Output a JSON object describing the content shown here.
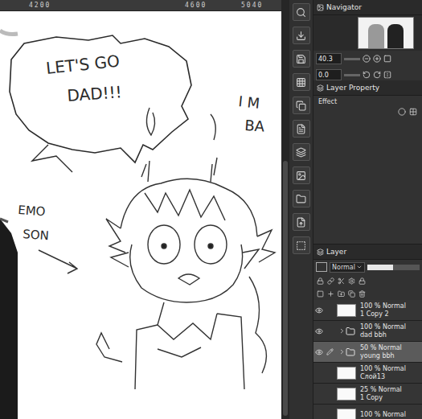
{
  "ruler": {
    "marks": [
      "4200",
      "4600",
      "5040"
    ]
  },
  "canvas": {
    "texts": [
      "LET'S GO",
      "DAD!!!",
      "I M",
      "BA",
      "EMO",
      "SON"
    ]
  },
  "navigator": {
    "title": "Navigator",
    "zoom": "40.3",
    "rotation": "0.0"
  },
  "property_panel": {
    "title": "Layer Property",
    "section": "Effect"
  },
  "layer_panel": {
    "title": "Layer",
    "blend_mode": "Normal",
    "opacity_level": 0.5,
    "layers": [
      {
        "status": "100 % Normal",
        "name": "1 Copy 2",
        "kind": "layer",
        "visible": true,
        "editing": false,
        "selected": false
      },
      {
        "status": "100 % Normal",
        "name": "dad bbh",
        "kind": "folder",
        "visible": true,
        "editing": false,
        "selected": false
      },
      {
        "status": "50 % Normal",
        "name": "young bbh",
        "kind": "folder",
        "visible": true,
        "editing": true,
        "selected": true
      },
      {
        "status": "100 % Normal",
        "name": "Слой13",
        "kind": "layer",
        "visible": false,
        "editing": false,
        "selected": false
      },
      {
        "status": "25 % Normal",
        "name": "1 Copy",
        "kind": "layer",
        "visible": false,
        "editing": false,
        "selected": false
      },
      {
        "status": "100 % Normal",
        "kind": "layer",
        "visible": false,
        "editing": false,
        "selected": false
      }
    ]
  }
}
